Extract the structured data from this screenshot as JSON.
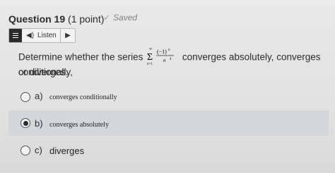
{
  "question": {
    "number_label": "Question 19",
    "points_label": "(1 point)",
    "status": "Saved"
  },
  "toolbar": {
    "listen_label": "Listen"
  },
  "prompt": {
    "before": "Determine whether the series",
    "after": "converges absolutely, converges conditionally,",
    "line2": "or diverges.",
    "series": {
      "upper_limit": "∞",
      "index": "n=1",
      "numerator": "(−1)",
      "exponent": "n",
      "denominator": "n",
      "denominator_exponent": "4"
    }
  },
  "options": [
    {
      "letter": "a)",
      "text": "converges conditionally",
      "selected": false
    },
    {
      "letter": "b)",
      "text": "converges absolutely",
      "selected": true
    },
    {
      "letter": "c)",
      "text": "diverges",
      "selected": false
    }
  ]
}
